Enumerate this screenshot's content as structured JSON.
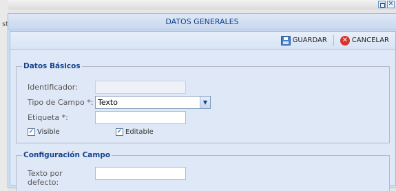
{
  "window": {
    "title": "DATOS GENERALES"
  },
  "toolbar": {
    "save_label": "GUARDAR",
    "cancel_label": "CANCELAR"
  },
  "background": {
    "fragment": "st"
  },
  "basic": {
    "legend": "Datos Básicos",
    "identificador": {
      "label": "Identificador:",
      "value": ""
    },
    "tipo_campo": {
      "label": "Tipo de Campo *:",
      "selected": "Texto"
    },
    "etiqueta": {
      "label": "Etiqueta *:",
      "value": ""
    },
    "visible": {
      "label": "Visible",
      "checked": true
    },
    "editable": {
      "label": "Editable",
      "checked": true
    }
  },
  "config": {
    "legend": "Configuración Campo",
    "texto_defecto": {
      "label_line1": "Texto por",
      "label_line2": "defecto:",
      "value": ""
    }
  }
}
